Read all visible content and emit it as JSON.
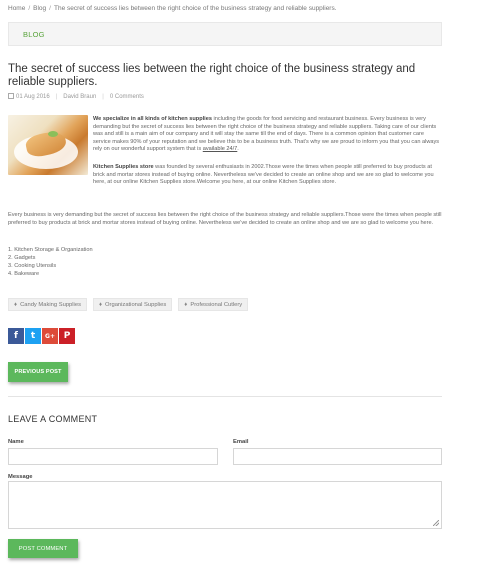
{
  "breadcrumb": {
    "home": "Home",
    "section": "Blog",
    "current": "The secret of success lies between the right choice of the business strategy and reliable suppliers."
  },
  "blog_bar": {
    "label": "BLOG"
  },
  "post": {
    "title": "The secret of success lies between the right choice of the business strategy and reliable suppliers.",
    "date": "01 Aug 2016",
    "author": "David Braun",
    "comments": "0 Comments",
    "p1_bold": "We specialize in all kinds of kitchen supplies",
    "p1_text": " including the goods for food servicing and restaurant business. Every business is very demanding but the secret of success lies between the right choice of the business strategy and reliable suppliers. Taking care of our clients was and still is a main aim of our company and it will stay the same till the end of days. There is a common opinion that customer care service makes 90% of your reputation and we believe this to be a business truth. That's why we are proud to inform you that you can always rely on our wonderful support system that is ",
    "p1_link": "available 24/7",
    "p1_end": ".",
    "p2_bold": "Kitchen Supplies store",
    "p2_text": " was founded by several enthusiasts in 2002.Those were the times when people still preferred to buy products at brick and mortar stores instead of buying online. Nevertheless we've decided to create an online shop and we are so glad to welcome you here, at our online Kitchen Supplies store.Welcome you here, at our online Kitchen Supplies store.",
    "p3": "Every business is very demanding but the secret of success lies between the right choice of the business strategy and reliable suppliers.Those were the times when people still preferred to buy products at brick and mortar stores instead of buying online. Nevertheless we've decided to create an online shop and we are so glad to welcome you here.",
    "list": [
      "1. Kitchen Storage & Organization",
      "2. Gadgets",
      "3. Cooking Utensils",
      "4. Bakeware"
    ]
  },
  "tags": [
    "Candy Making Supplies",
    "Organizational Supplies",
    "Professional Cutlery"
  ],
  "social": {
    "facebook": "f",
    "twitter": "t",
    "googleplus": "G+",
    "pinterest": "P"
  },
  "buttons": {
    "previous_post": "PREVIOUS POST",
    "post_comment": "POST COMMENT"
  },
  "comment_form": {
    "title": "LEAVE A COMMENT",
    "name_label": "Name",
    "email_label": "Email",
    "message_label": "Message",
    "name_value": "",
    "email_value": "",
    "message_value": ""
  },
  "colors": {
    "accent": "#5cb85c",
    "bar_text": "#5aa43c",
    "facebook": "#3b5998",
    "twitter": "#1da1f2",
    "googleplus": "#dd4b39",
    "pinterest": "#cb2027"
  },
  "icons": {
    "date": "calendar-icon",
    "tag": "tag-icon"
  }
}
